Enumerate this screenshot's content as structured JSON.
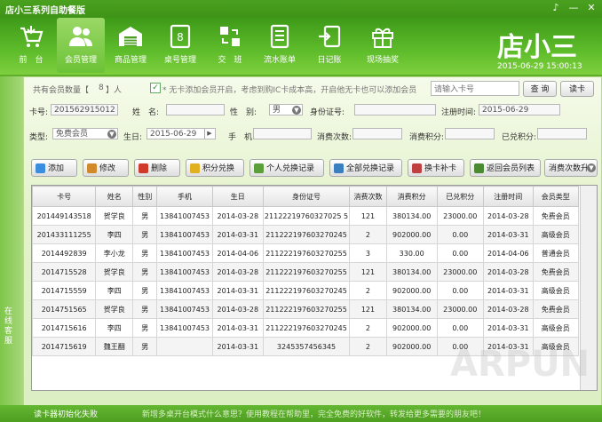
{
  "window": {
    "title": "店小三系列自助餐版",
    "controls": [
      "♪",
      "—",
      "✕"
    ]
  },
  "nav": [
    {
      "id": "front",
      "label": "前　台",
      "icon": "cart-icon"
    },
    {
      "id": "members",
      "label": "会员管理",
      "icon": "users-icon",
      "active": true
    },
    {
      "id": "products",
      "label": "商品管理",
      "icon": "warehouse-icon"
    },
    {
      "id": "tables",
      "label": "桌号管理",
      "icon": "table-number-icon"
    },
    {
      "id": "shift",
      "label": "交　班",
      "icon": "exchange-icon"
    },
    {
      "id": "ledger",
      "label": "流水账单",
      "icon": "bill-icon"
    },
    {
      "id": "journal",
      "label": "日记账",
      "icon": "journal-icon"
    },
    {
      "id": "lottery",
      "label": "现场抽奖",
      "icon": "gift-icon"
    }
  ],
  "brand": {
    "logo_text": "店小三",
    "datetime": "2015-06-29 15:00:13"
  },
  "summary": {
    "member_count_prefix": "共有会员数量【",
    "member_count": "8",
    "member_count_suffix": "】人",
    "no_card_note": "* 无卡添加会员开启，考虑到购IC卡成本高，开启他无卡也可以添加会员",
    "search_placeholder": "请输入卡号",
    "query_label": "查 询",
    "read_card_label": "读卡"
  },
  "form": {
    "card_no_label": "卡号:",
    "card_no_value": "201562915012",
    "name_label": "姓　名:",
    "gender_label": "性　别:",
    "gender_value": "男",
    "id_label": "身份证号:",
    "reg_time_label": "注册时间:",
    "reg_time_value": "2015-06-29",
    "type_label": "类型:",
    "type_value": "免费会员",
    "birthday_label": "生日:",
    "birthday_value": "2015-06-29",
    "phone_label": "手　机",
    "consume_count_label": "消费次数:",
    "consume_points_label": "消费积分:",
    "redeemed_points_label": "已兑积分:"
  },
  "toolbar": [
    {
      "label": "添加",
      "icon": "add-icon",
      "color": "#3b8de0"
    },
    {
      "label": "修改",
      "icon": "edit-icon",
      "color": "#d08a2a"
    },
    {
      "label": "删除",
      "icon": "delete-icon",
      "color": "#d03a2a"
    },
    {
      "label": "积分兑换",
      "icon": "points-icon",
      "color": "#e0b020"
    },
    {
      "label": "个人兑换记录",
      "icon": "personal-record-icon",
      "color": "#5a9f3a"
    },
    {
      "label": "全部兑换记录",
      "icon": "all-record-icon",
      "color": "#3a7fbf"
    },
    {
      "label": "换卡补卡",
      "icon": "card-icon",
      "color": "#c04040"
    },
    {
      "label": "返回会员列表",
      "icon": "return-icon",
      "color": "#4a8a30"
    },
    {
      "label": "消费次数升",
      "icon": "dropdown-icon",
      "color": "#777777"
    }
  ],
  "table": {
    "columns": [
      "卡号",
      "姓名",
      "性别",
      "手机",
      "生日",
      "身份证号",
      "消费次数",
      "消费积分",
      "已兑积分",
      "注册时间",
      "会员类型"
    ],
    "rows": [
      [
        "201449143518",
        "贺学良",
        "男",
        "13841007453",
        "2014-03-28",
        "21122219760327025 5",
        "121",
        "380134.00",
        "23000.00",
        "2014-03-28",
        "免费会员"
      ],
      [
        "201433111255",
        "李四",
        "男",
        "13841007453",
        "2014-03-31",
        "211222197603270245",
        "2",
        "902000.00",
        "0.00",
        "2014-03-31",
        "高级会员"
      ],
      [
        "2014492839",
        "李小龙",
        "男",
        "13841007453",
        "2014-04-06",
        "211222197603270255",
        "3",
        "330.00",
        "0.00",
        "2014-04-06",
        "普通会员"
      ],
      [
        "2014715528",
        "贺学良",
        "男",
        "13841007453",
        "2014-03-28",
        "211222197603270255",
        "121",
        "380134.00",
        "23000.00",
        "2014-03-28",
        "免费会员"
      ],
      [
        "2014715559",
        "李四",
        "男",
        "13841007453",
        "2014-03-31",
        "211222197603270245",
        "2",
        "902000.00",
        "0.00",
        "2014-03-31",
        "高级会员"
      ],
      [
        "2014751565",
        "贺学良",
        "男",
        "13841007453",
        "2014-03-28",
        "211222197603270255",
        "121",
        "380134.00",
        "23000.00",
        "2014-03-28",
        "免费会员"
      ],
      [
        "2014715616",
        "李四",
        "男",
        "13841007453",
        "2014-03-31",
        "211222197603270245",
        "2",
        "902000.00",
        "0.00",
        "2014-03-31",
        "高级会员"
      ],
      [
        "2014715619",
        "魏王翻",
        "男",
        "",
        "2014-03-31",
        "3245357456345",
        "2",
        "902000.00",
        "0.00",
        "2014-03-31",
        "高级会员"
      ]
    ]
  },
  "sidebar": {
    "service_label": "在线客服"
  },
  "status": {
    "left": "读卡器初始化失败",
    "marquee": "新增多桌开台模式什么意思？使用教程在帮助里，完全免费的好软件，转发给更多需要的朋友吧！"
  },
  "watermark": "ARPUN"
}
